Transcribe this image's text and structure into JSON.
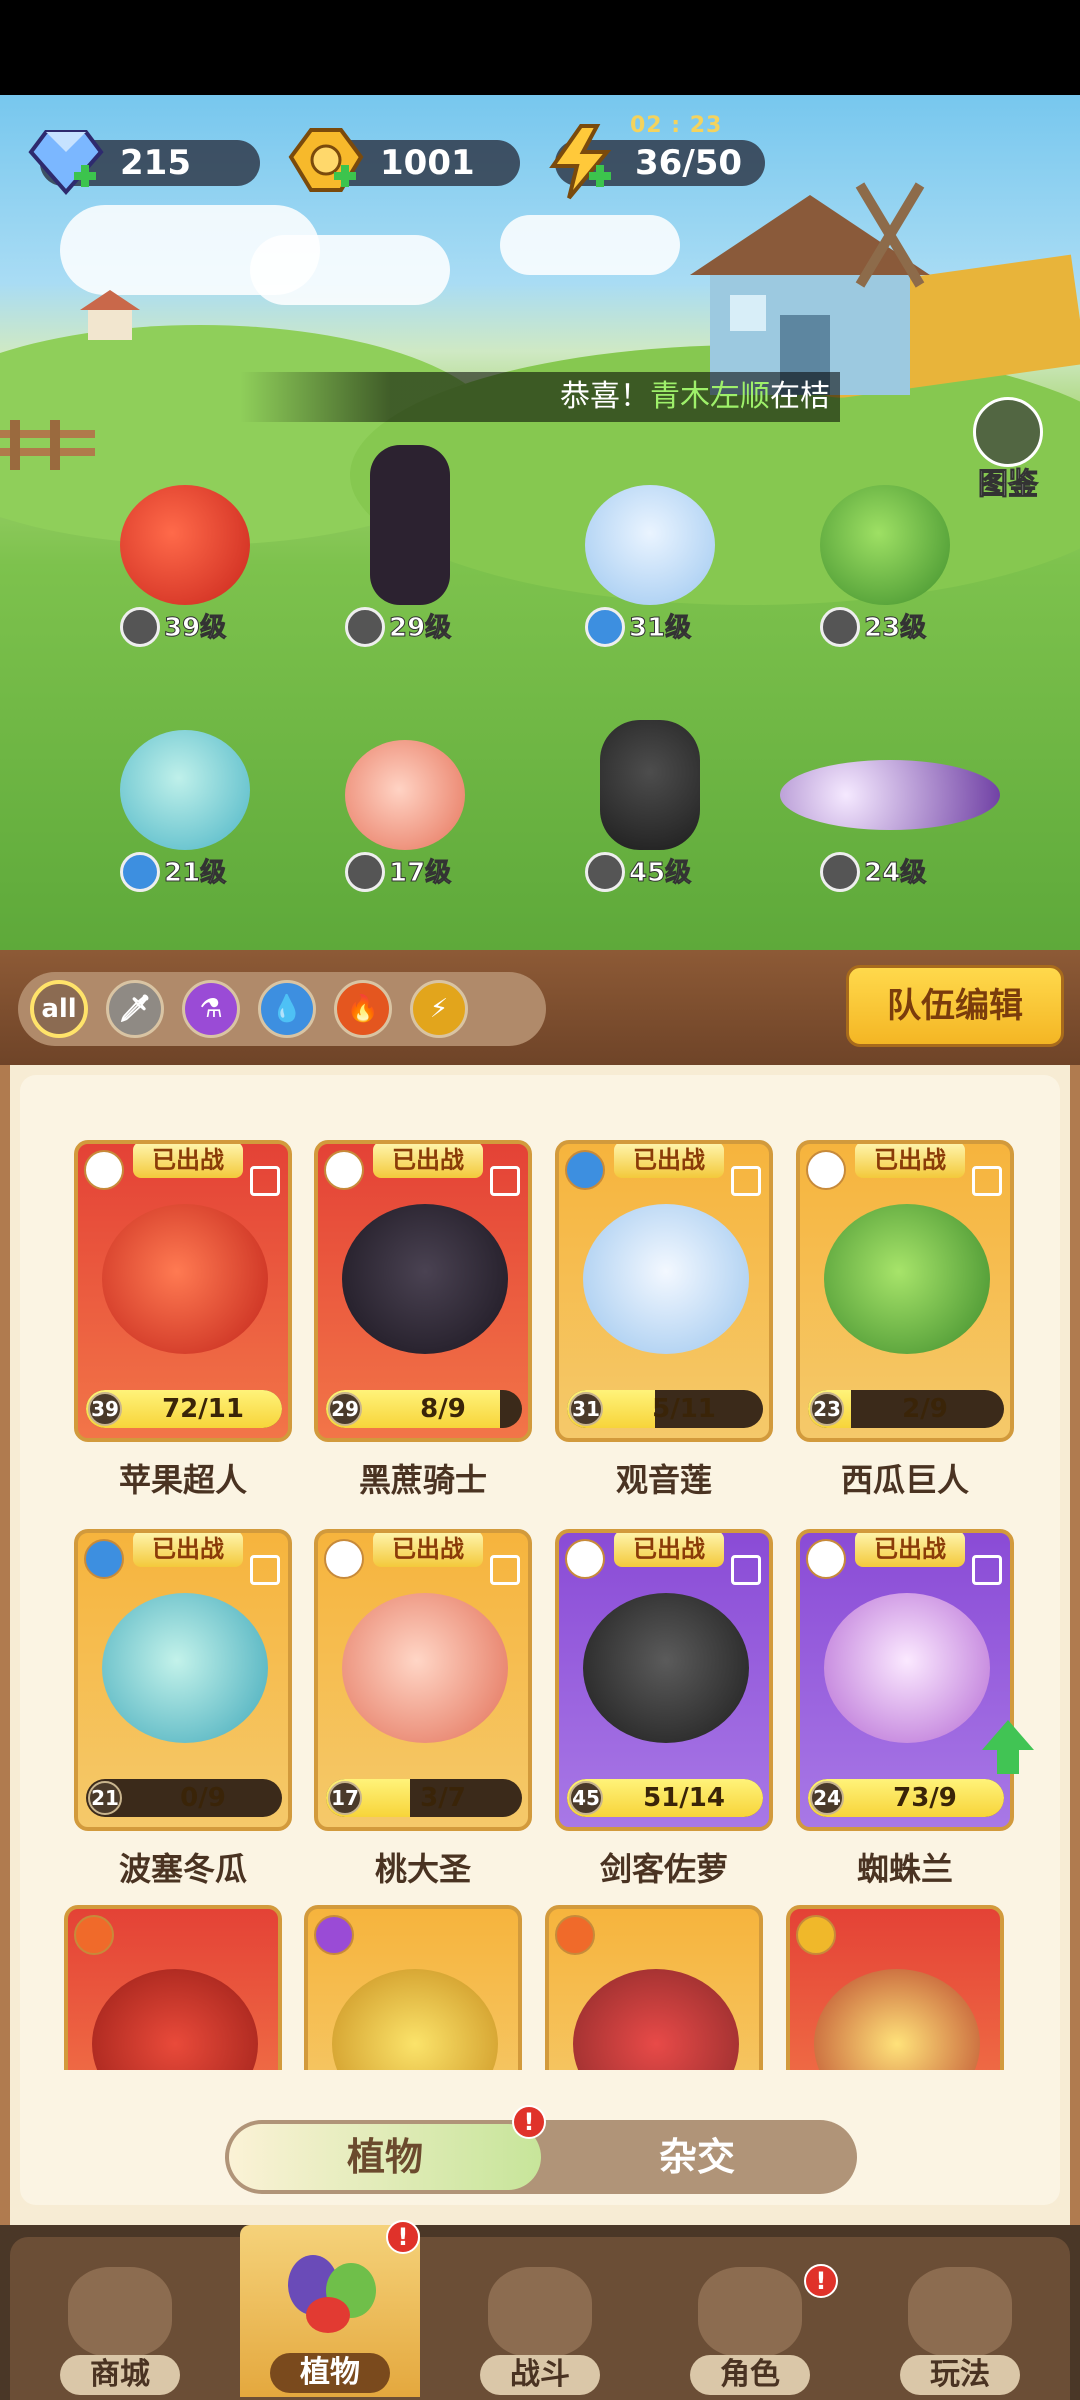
{
  "resources": {
    "diamond": "215",
    "gold": "1001",
    "energy": "36/50",
    "energy_timer": "02 : 23"
  },
  "announcement": {
    "prefix": "恭喜！",
    "name": "青木左顺",
    "suffix": "在桔"
  },
  "tujian_label": "图鉴",
  "team_heroes": [
    {
      "level": "39级"
    },
    {
      "level": "29级"
    },
    {
      "level": "31级"
    },
    {
      "level": "23级"
    },
    {
      "level": "21级"
    },
    {
      "level": "17级"
    },
    {
      "level": "45级"
    },
    {
      "level": "24级"
    }
  ],
  "filters": {
    "all": "all",
    "icons": [
      "sword-icon",
      "potion-icon",
      "water-drop-icon",
      "fire-icon",
      "lightning-icon"
    ]
  },
  "team_edit_label": "队伍编辑",
  "deployed_badge": "已出战",
  "cards": [
    {
      "name": "苹果超人",
      "level": "39",
      "count": "72/11",
      "progress": 1.0,
      "style": "red"
    },
    {
      "name": "黑蔗骑士",
      "level": "29",
      "count": "8/9",
      "progress": 0.89,
      "style": "red"
    },
    {
      "name": "观音莲",
      "level": "31",
      "count": "5/11",
      "progress": 0.45,
      "style": "gold"
    },
    {
      "name": "西瓜巨人",
      "level": "23",
      "count": "2/9",
      "progress": 0.22,
      "style": "gold"
    },
    {
      "name": "波塞冬瓜",
      "level": "21",
      "count": "0/9",
      "progress": 0.0,
      "style": "gold"
    },
    {
      "name": "桃大圣",
      "level": "17",
      "count": "3/7",
      "progress": 0.43,
      "style": "gold"
    },
    {
      "name": "剑客佐萝",
      "level": "45",
      "count": "51/14",
      "progress": 1.0,
      "style": "purple"
    },
    {
      "name": "蜘蛛兰",
      "level": "24",
      "count": "73/9",
      "progress": 1.0,
      "style": "purple"
    }
  ],
  "segment": {
    "plants": "植物",
    "hybrid": "杂交",
    "alert": "!"
  },
  "nav": [
    {
      "label": "商城"
    },
    {
      "label": "植物"
    },
    {
      "label": "战斗"
    },
    {
      "label": "角色"
    },
    {
      "label": "玩法"
    }
  ],
  "colors": {
    "accent_gold": "#f4b624",
    "panel_bg": "#fbf4e3",
    "nav_bg": "#6b4e36",
    "alert_red": "#e0322a"
  }
}
